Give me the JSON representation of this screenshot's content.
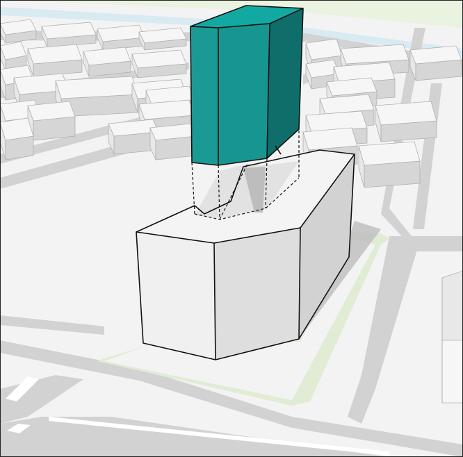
{
  "colors": {
    "ground": "#f3f3f3",
    "road": "#d2d2d2",
    "road_marking": "#ffffff",
    "green_strip": "#e0ecd4",
    "water": "#d8eaf2",
    "park": "#eaf2e0",
    "block_top": "#f6f6f6",
    "block_left": "#e8e8e8",
    "block_right": "#d6d6d6",
    "block_edge": "#b0b0b0",
    "building_top": "#f4f4f4",
    "building_left": "#f0f0f0",
    "building_mid": "#dedede",
    "building_right": "#d2d2d2",
    "courtyard": "#e2e2e2",
    "shadow": "#bdbdbd",
    "tower_left": "#1b9a95",
    "tower_front": "#179590",
    "tower_right": "#0f6e6a",
    "tower_top": "#13a9a3",
    "outline": "#111111"
  },
  "icons": {
    "tower": "teal-tower-volume",
    "podium": "podium-block",
    "city": "context-blocks"
  }
}
